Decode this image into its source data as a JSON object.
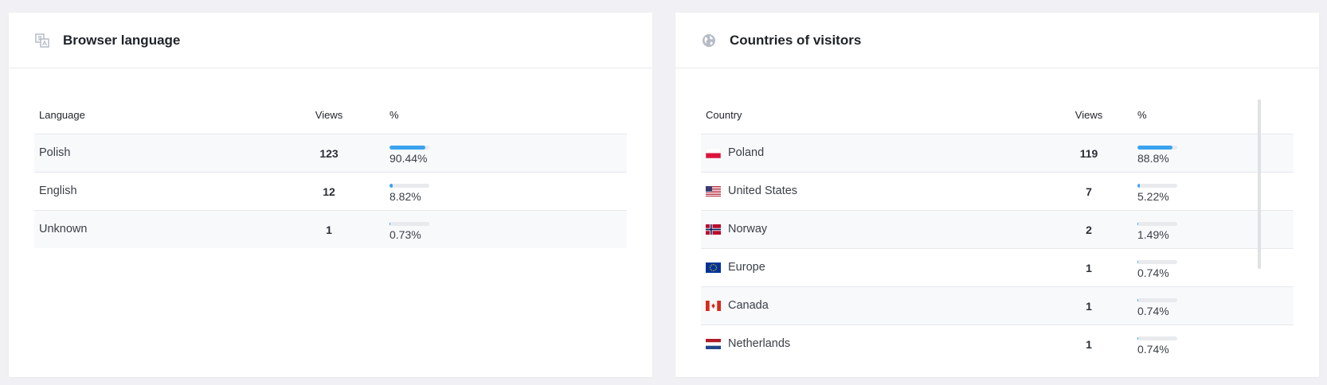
{
  "language_card": {
    "title": "Browser language",
    "icon": "translate-icon",
    "columns": [
      "Language",
      "Views",
      "%"
    ],
    "rows": [
      {
        "label": "Polish",
        "views": "123",
        "pct_text": "90.44%",
        "pct": 90.44
      },
      {
        "label": "English",
        "views": "12",
        "pct_text": "8.82%",
        "pct": 8.82
      },
      {
        "label": "Unknown",
        "views": "1",
        "pct_text": "0.73%",
        "pct": 0.73
      }
    ]
  },
  "country_card": {
    "title": "Countries of visitors",
    "icon": "globe-icon",
    "columns": [
      "Country",
      "Views",
      "%"
    ],
    "rows": [
      {
        "label": "Poland",
        "flag": "pl-flag-icon",
        "views": "119",
        "pct_text": "88.8%",
        "pct": 88.8
      },
      {
        "label": "United States",
        "flag": "us-flag-icon",
        "views": "7",
        "pct_text": "5.22%",
        "pct": 5.22
      },
      {
        "label": "Norway",
        "flag": "no-flag-icon",
        "views": "2",
        "pct_text": "1.49%",
        "pct": 1.49
      },
      {
        "label": "Europe",
        "flag": "eu-flag-icon",
        "views": "1",
        "pct_text": "0.74%",
        "pct": 0.74
      },
      {
        "label": "Canada",
        "flag": "ca-flag-icon",
        "views": "1",
        "pct_text": "0.74%",
        "pct": 0.74
      },
      {
        "label": "Netherlands",
        "flag": "nl-flag-icon",
        "views": "1",
        "pct_text": "0.74%",
        "pct": 0.74
      }
    ]
  },
  "colors": {
    "bar_fill": "#3aa3ef",
    "bar_track": "#e8eaee",
    "icon_gray": "#b6bcc6"
  }
}
